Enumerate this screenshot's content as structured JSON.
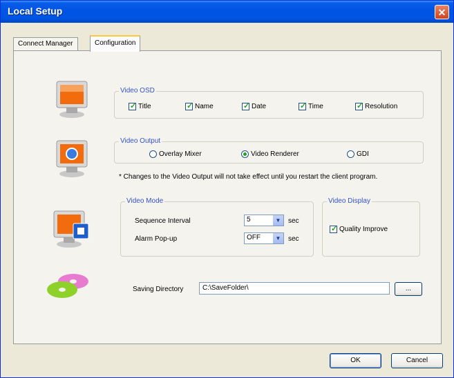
{
  "window": {
    "title": "Local Setup",
    "close_glyph": "✕"
  },
  "tabs": [
    {
      "label": "Connect Manager",
      "active": false
    },
    {
      "label": "Configuration",
      "active": true
    }
  ],
  "video_osd": {
    "title": "Video OSD",
    "options": [
      {
        "label": "Title",
        "checked": true
      },
      {
        "label": "Name",
        "checked": true
      },
      {
        "label": "Date",
        "checked": true
      },
      {
        "label": "Time",
        "checked": true
      },
      {
        "label": "Resolution",
        "checked": true
      }
    ]
  },
  "video_output": {
    "title": "Video Output",
    "options": [
      {
        "label": "Overlay Mixer",
        "selected": false
      },
      {
        "label": "Video Renderer",
        "selected": true
      },
      {
        "label": "GDI",
        "selected": false
      }
    ],
    "note": "* Changes to the Video Output will not take effect until you restart the client program."
  },
  "video_mode": {
    "title": "Video Mode",
    "sequence_interval_label": "Sequence Interval",
    "sequence_interval_value": "5",
    "sequence_unit": "sec",
    "alarm_popup_label": "Alarm Pop-up",
    "alarm_popup_value": "OFF",
    "alarm_unit": "sec"
  },
  "video_display": {
    "title": "Video Display",
    "quality_label": "Quality Improve",
    "quality_checked": true
  },
  "saving": {
    "label": "Saving Directory",
    "value": "C:\\SaveFolder\\",
    "browse_label": "..."
  },
  "footer": {
    "ok_label": "OK",
    "cancel_label": "Cancel"
  },
  "icons": {
    "monitor_osd": "monitor-osd-icon",
    "monitor_output": "monitor-output-icon",
    "monitor_mode": "monitor-mode-icon",
    "discs": "cd-discs-icon"
  },
  "colors": {
    "title_bar": "#0054e3",
    "group_title": "#3353c8",
    "check": "#21a121"
  }
}
